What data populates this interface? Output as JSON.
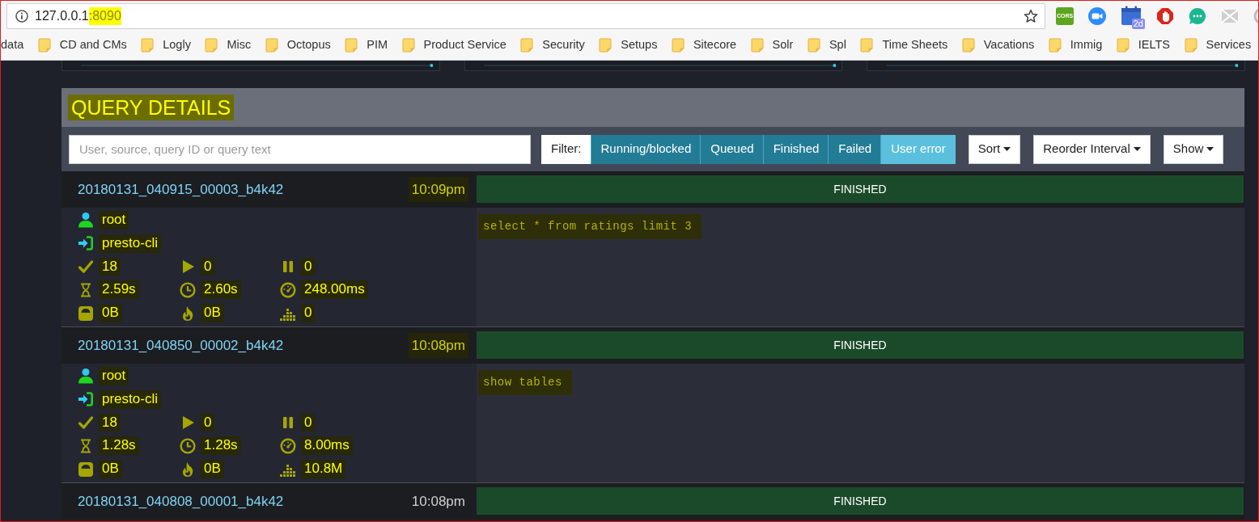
{
  "browser": {
    "url": [
      {
        "text": "127.0.0.1",
        "highlighted": false
      },
      {
        "text": ":8090",
        "highlighted": true
      }
    ],
    "extensions": [
      {
        "kind": "cors",
        "label": "CORS"
      },
      {
        "kind": "camera"
      },
      {
        "kind": "calendar",
        "badge": "2d"
      },
      {
        "kind": "stop"
      },
      {
        "kind": "chat"
      },
      {
        "kind": "mail"
      },
      {
        "kind": "circle"
      }
    ],
    "bookmarks": [
      {
        "label": "data",
        "folder": false
      },
      {
        "label": "CD and CMs",
        "folder": true
      },
      {
        "label": "Logly",
        "folder": true
      },
      {
        "label": "Misc",
        "folder": true
      },
      {
        "label": "Octopus",
        "folder": true
      },
      {
        "label": "PIM",
        "folder": true
      },
      {
        "label": "Product Service",
        "folder": true
      },
      {
        "label": "Security",
        "folder": true
      },
      {
        "label": "Setups",
        "folder": true
      },
      {
        "label": "Sitecore",
        "folder": true
      },
      {
        "label": "Solr",
        "folder": true
      },
      {
        "label": "Spl",
        "folder": true
      },
      {
        "label": "Time Sheets",
        "folder": true
      },
      {
        "label": "Vacations",
        "folder": true
      },
      {
        "label": "Immig",
        "folder": true
      },
      {
        "label": "IELTS",
        "folder": true
      },
      {
        "label": "Services",
        "folder": true
      }
    ]
  },
  "charts": [
    {
      "kind": "sparkline"
    },
    {
      "kind": "sparkline"
    },
    {
      "kind": "sparkline"
    }
  ],
  "panel": {
    "title": {
      "text": "QUERY DETAILS",
      "highlighted": true
    },
    "search": {
      "placeholder": "User, source, query ID or query text"
    },
    "filter": {
      "label": "Filter:",
      "options": [
        {
          "label": "Running/blocked",
          "selected": true
        },
        {
          "label": "Queued",
          "selected": true
        },
        {
          "label": "Finished",
          "selected": true
        },
        {
          "label": "Failed",
          "selected": true
        },
        {
          "label": "User error",
          "selected": false
        }
      ]
    },
    "dropdowns": [
      "Sort",
      "Reorder Interval",
      "Show"
    ],
    "queries": [
      {
        "id": "20180131_040915_00003_b4k42",
        "time": "10:09pm",
        "status": "FINISHED",
        "highlighted": true,
        "user": "root",
        "source": "presto-cli",
        "stats": [
          {
            "kind": "check",
            "value": "18"
          },
          {
            "kind": "play",
            "value": "0"
          },
          {
            "kind": "pause",
            "value": "0"
          },
          {
            "kind": "hourglass",
            "value": "2.59s"
          },
          {
            "kind": "clock",
            "value": "2.60s"
          },
          {
            "kind": "gauge",
            "value": "248.00ms"
          },
          {
            "kind": "scale",
            "value": "0B"
          },
          {
            "kind": "flame",
            "value": "0B"
          },
          {
            "kind": "bars",
            "value": "0"
          }
        ],
        "query_text": "select * from ratings limit 3"
      },
      {
        "id": "20180131_040850_00002_b4k42",
        "time": "10:08pm",
        "status": "FINISHED",
        "highlighted": true,
        "user": "root",
        "source": "presto-cli",
        "stats": [
          {
            "kind": "check",
            "value": "18"
          },
          {
            "kind": "play",
            "value": "0"
          },
          {
            "kind": "pause",
            "value": "0"
          },
          {
            "kind": "hourglass",
            "value": "1.28s"
          },
          {
            "kind": "clock",
            "value": "1.28s"
          },
          {
            "kind": "gauge",
            "value": "8.00ms"
          },
          {
            "kind": "scale",
            "value": "0B"
          },
          {
            "kind": "flame",
            "value": "0B"
          },
          {
            "kind": "bars",
            "value": "10.8M"
          }
        ],
        "query_text": "show tables"
      },
      {
        "id": "20180131_040808_00001_b4k42",
        "time": "10:08pm",
        "status": "FINISHED",
        "highlighted": false
      }
    ]
  }
}
